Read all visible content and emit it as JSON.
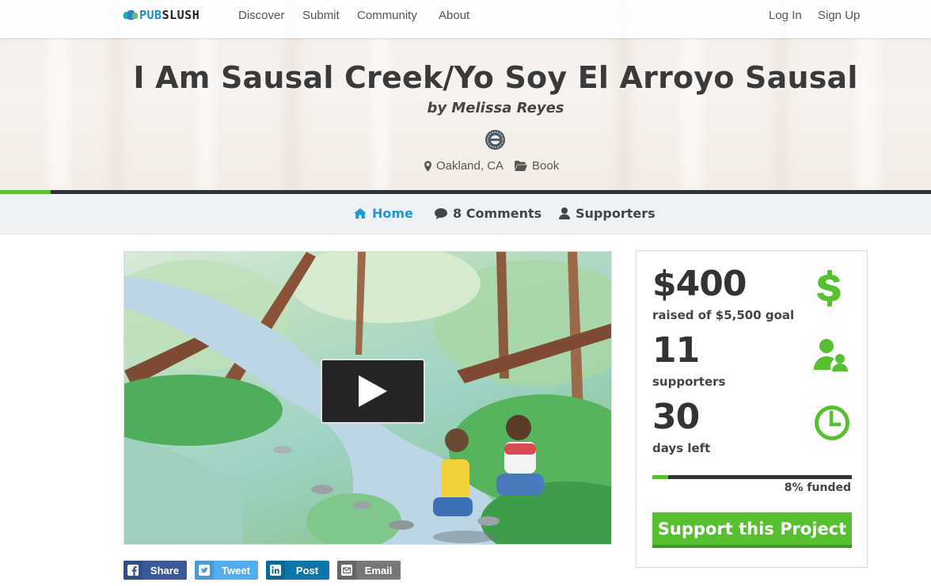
{
  "brand": {
    "logo_text": "PUBSLUSH"
  },
  "nav": {
    "links": [
      "Discover",
      "Submit",
      "Community",
      "About"
    ],
    "login": "Log In",
    "signup": "Sign Up"
  },
  "project": {
    "title": "I Am Sausal Creek/Yo Soy El Arroyo Sausal",
    "byline": "by Melissa Reyes",
    "location": "Oakland, CA",
    "category": "Book",
    "funded_fraction": 0.08
  },
  "tabs": {
    "home": "Home",
    "comments": "8 Comments",
    "supporters": "Supporters"
  },
  "video": {
    "play_icon": "play-icon"
  },
  "share": {
    "facebook": "Share",
    "twitter": "Tweet",
    "linkedin": "Post",
    "email": "Email"
  },
  "stats": {
    "raised": "$400",
    "raised_label": "raised of $5,500 goal",
    "supporters": "11",
    "supporters_label": "supporters",
    "days": "30",
    "days_label": "days left",
    "funded_label": "8% funded",
    "cta": "Support this Project"
  },
  "colors": {
    "accent": "#56c030",
    "link_active": "#1e97d4",
    "facebook": "#3b5998",
    "twitter": "#55acee",
    "linkedin": "#0e76a8",
    "email": "#777777"
  }
}
